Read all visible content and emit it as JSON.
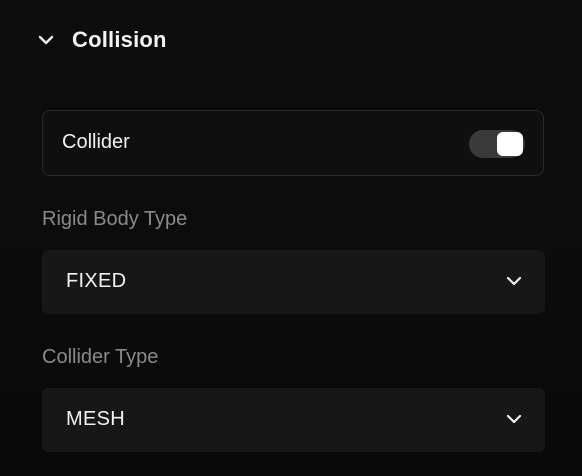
{
  "section": {
    "title": "Collision",
    "expand_icon": "chevron-down-icon"
  },
  "collider_toggle": {
    "label": "Collider",
    "enabled": true
  },
  "rigid_body": {
    "label": "Rigid Body Type",
    "value": "FIXED",
    "icon": "chevron-down-icon"
  },
  "collider_type": {
    "label": "Collider Type",
    "value": "MESH",
    "icon": "chevron-down-icon"
  },
  "colors": {
    "background": "#0b0b0b",
    "text": "#f2f2f2",
    "label_muted": "#8a8a8a",
    "field_bg": "#171717",
    "switch_track": "#3a3a3a",
    "switch_knob": "#ffffff"
  }
}
